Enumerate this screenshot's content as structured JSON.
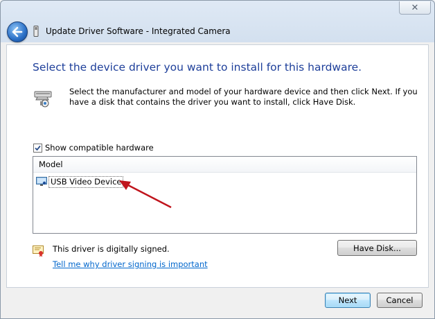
{
  "window": {
    "title": "Update Driver Software - Integrated Camera",
    "close_glyph": "✕"
  },
  "content": {
    "heading": "Select the device driver you want to install for this hardware.",
    "description": "Select the manufacturer and model of your hardware device and then click Next. If you have a disk that contains the driver you want to install, click Have Disk.",
    "show_compatible_label": "Show compatible hardware",
    "show_compatible_checked": true,
    "model_list": {
      "header": "Model",
      "items": [
        {
          "label": "USB Video Device",
          "icon": "video-device-icon",
          "selected": true
        }
      ]
    },
    "signed_text": "This driver is digitally signed.",
    "signing_link": "Tell me why driver signing is important"
  },
  "buttons": {
    "have_disk": "Have Disk...",
    "next": "Next",
    "cancel": "Cancel"
  },
  "colors": {
    "heading": "#1e3f9a",
    "link": "#0066cc",
    "annotation_arrow": "#c0141c"
  }
}
